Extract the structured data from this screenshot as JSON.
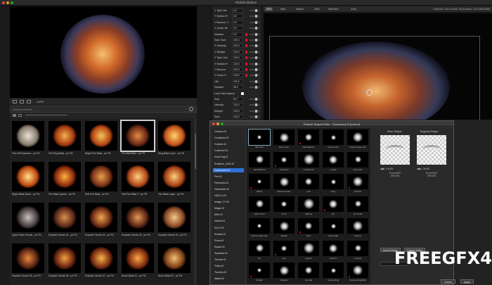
{
  "window": {
    "title": "Particle Illusion"
  },
  "preview": {
    "zoom": "100%"
  },
  "search": {
    "placeholder": "Search emitters"
  },
  "library": {
    "items": [
      {
        "label": "Fine Hit Explosion - pe FN"
      },
      {
        "label": "Fire Ring Blast - pe FN"
      },
      {
        "label": "Bright Fire Blast - pe FN"
      },
      {
        "label": "Fire Ball Blast - pe FN"
      },
      {
        "label": "Ring Blast Layer - pe FN"
      },
      {
        "label": "Bright Blast Quick - pe FN"
      },
      {
        "label": "Fire Blast Sparks - pe FN"
      },
      {
        "label": "Soft Fire Blast - pe FN"
      },
      {
        "label": "Soft Fire Blast 2 - pe FN"
      },
      {
        "label": "Fire Blast Large - pe FN"
      },
      {
        "label": "Quick Flash Smoke - pe FN"
      },
      {
        "label": "Explode Clouds 01 - pe FN"
      },
      {
        "label": "Explode Clouds 02 - pe FN"
      },
      {
        "label": "Explode Clouds 03 - pe FN"
      },
      {
        "label": "Explode Clouds 04 - pe FN"
      },
      {
        "label": "Explode Clouds 05 - pe FN"
      },
      {
        "label": "Explode Clouds 06 - pe FN"
      },
      {
        "label": "Explode Clouds 07 - pe FN"
      },
      {
        "label": "Boom Blast 01 - pe FN"
      },
      {
        "label": "Boom Blast 02 - pe FN"
      }
    ]
  },
  "properties": {
    "rows": [
      {
        "label": "Y Spin Var",
        "value": "0.0"
      },
      {
        "label": "Y Motion R",
        "value": "0.0"
      },
      {
        "label": "Y Bounce V",
        "value": "0.0"
      },
      {
        "label": "Y Zoom Va",
        "value": "0.0"
      },
      {
        "label": "Number",
        "value": "0.0"
      },
      {
        "label": "Size Over",
        "value": "100.0"
      },
      {
        "label": "Y Velocity",
        "value": "100.0"
      },
      {
        "label": "Y Weight",
        "value": "100.0"
      },
      {
        "label": "Y Spin Ove",
        "value": "100.0"
      },
      {
        "label": "Y Motion R",
        "value": "100.0"
      },
      {
        "label": "Y Bounce",
        "value": "100.0"
      },
      {
        "label": "Y Zoom O",
        "value": "100.0"
      },
      {
        "label": "Life",
        "value": "200.0"
      },
      {
        "label": "Number",
        "value": "38.0"
      },
      {
        "label": "Lock Size Aspect",
        "value": ""
      },
      {
        "label": "Size",
        "value": "50.7"
      },
      {
        "label": "Velocity",
        "value": "100.0"
      },
      {
        "label": "Weight",
        "value": "200.0"
      },
      {
        "label": "Spin",
        "value": "100.0"
      },
      {
        "label": "Motion Ran",
        "value": "0.0"
      }
    ],
    "bottom": [
      {
        "label": "Size",
        "value": "60.0"
      },
      {
        "label": "Velocity",
        "value": "40.0"
      }
    ]
  },
  "viewport": {
    "tabs": [
      "93%",
      "Wire",
      "Motion",
      "HUD",
      "Selection",
      "Zone"
    ],
    "info": "Particles: 243   Current: 35   Duration: 125   1920x1080"
  },
  "dialog": {
    "title": "Particle Shape Editor - Explosions.t3 (locked)",
    "categories": [
      "Cartoon.t3",
      "Creatures.t3",
      "Custom.t3",
      "Custom2.t3",
      "Dust-Fog.t3",
      "Emitters_2020.t3",
      "Explosions.t3",
      "Fire.t3",
      "Fireworks.t3",
      "Geometric.t3",
      "HUD-UI.t3",
      "Image_FX.t3",
      "Magic.t3",
      "Misc.t3",
      "Nature.t3",
      "Sci-Fi.t3",
      "Smoke.t3",
      "Snow.t3",
      "Space.t3",
      "Sparkles.t3",
      "Texture.t3",
      "Trails.t3",
      "Tunnels.t3",
      "Water.t3"
    ],
    "selected_category": "Explosions.t3",
    "shapes": [
      "flare star",
      "bloom star",
      "waterfall blur",
      "blurred star",
      "blurred splay star",
      "waterfall blur",
      "cloudy hit",
      "medium hit",
      "smoke",
      "star burst",
      "flash3",
      "Flare(thunder)",
      "puff",
      "spray",
      "puff blur",
      "spark cloud",
      "burst",
      "debris2",
      "fire",
      "hot cloud",
      "blurred splay star",
      "particle",
      "star2",
      "burst splat",
      "cloud 2",
      "fire",
      "star",
      "spark 2",
      "spark 5",
      "coronas",
      "fireball",
      "fireball 2",
      "fire ball",
      "Smoke Ring",
      "Smoke_Ring0001"
    ],
    "new_shape": {
      "heading": "New Shape",
      "counter": "1 of 63",
      "name": "Dome2000",
      "size": "256x256"
    },
    "original_shape": {
      "heading": "Original Shape",
      "counter": "1 of 63",
      "name": "Dome2000",
      "size": "256x256"
    },
    "import_label": "Import Shape",
    "custom_label": "Custom Editor",
    "cancel_label": "Cancel",
    "apply_label": "Apply"
  },
  "watermark": "FREEGFX4U"
}
